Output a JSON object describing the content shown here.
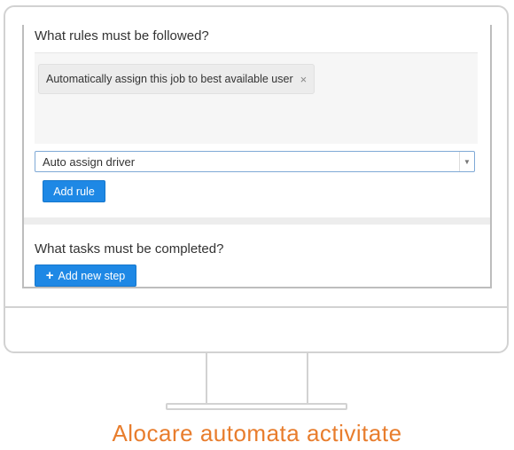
{
  "rules_section": {
    "title": "What rules must be followed?",
    "tags": [
      {
        "label": "Automatically assign this job to best available user",
        "remove_glyph": "×"
      }
    ],
    "select": {
      "value": "Auto assign driver",
      "arrow_glyph": "▼"
    },
    "add_rule_label": "Add rule"
  },
  "tasks_section": {
    "title": "What tasks must be completed?",
    "add_step_label": "Add new step",
    "add_step_icon": "+"
  },
  "caption": "Alocare automata activitate",
  "colors": {
    "accent": "#1e88e5",
    "caption": "#e87d2d",
    "frame": "#d2d2d2"
  }
}
